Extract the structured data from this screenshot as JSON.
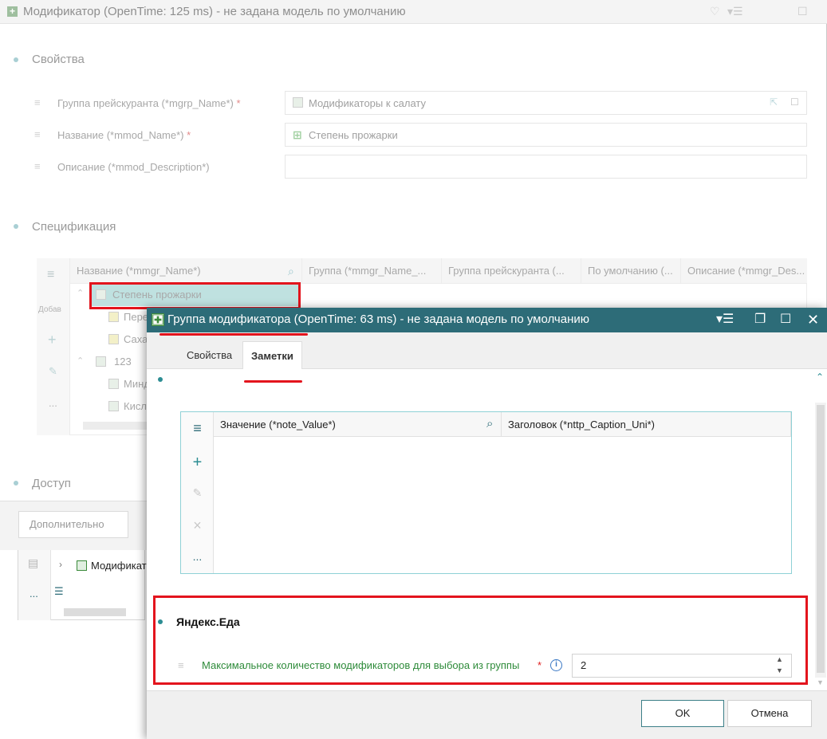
{
  "background_window": {
    "title": "Модификатор (OpenTime: 125 ms) - не задана модель по умолчанию",
    "sections": {
      "properties": "Свойства",
      "specification": "Спецификация",
      "access": "Доступ"
    },
    "fields": [
      {
        "label": "Группа прейскуранта (*mgrp_Name*)",
        "required": "*",
        "value": "Модификаторы к салату"
      },
      {
        "label": "Название (*mmod_Name*)",
        "required": "*",
        "value": "Степень прожарки"
      },
      {
        "label": "Описание (*mmod_Description*)",
        "required": "",
        "value": ""
      }
    ],
    "grid": {
      "side_label": "Добав",
      "columns": [
        "Название (*mmgr_Name*)",
        "Группа (*mmgr_Name_...",
        "Группа прейскуранта (...",
        "По умолчанию (...",
        "Описание (*mmgr_Des..."
      ],
      "rows": [
        {
          "label": "Степень прожарки"
        },
        {
          "label": "Пере"
        },
        {
          "label": "Саха"
        },
        {
          "label": "123"
        },
        {
          "label": "Минд"
        },
        {
          "label": "Кисл"
        }
      ]
    },
    "extra_button": "Дополнительно",
    "strip_item": "Модификат",
    "strip_more": "..."
  },
  "dialog": {
    "title": "Группа модификатора (OpenTime: 63 ms) - не задана модель по умолчанию",
    "tabs": [
      {
        "label": "Свойства",
        "active": false
      },
      {
        "label": "Заметки",
        "active": true
      }
    ],
    "notes_grid": {
      "columns": [
        "Значение (*note_Value*)",
        "Заголовок (*nttp_Caption_Uni*)"
      ],
      "side_buttons": {
        "menu": "≡",
        "add": "+",
        "edit": "✎",
        "delete": "×",
        "more": "..."
      }
    },
    "yandex": {
      "title": "Яндекс.Еда",
      "field_label": "Максимальное количество модификаторов для выбора из группы",
      "required": "*",
      "info": "i",
      "value": "2"
    },
    "ok_label": "OK",
    "cancel_label": "Отмена"
  },
  "colors": {
    "titlebar": "#2d6c78",
    "accent_teal": "#2c8d93",
    "highlight_red": "#e3141d",
    "label_green": "#2e8b3a"
  }
}
